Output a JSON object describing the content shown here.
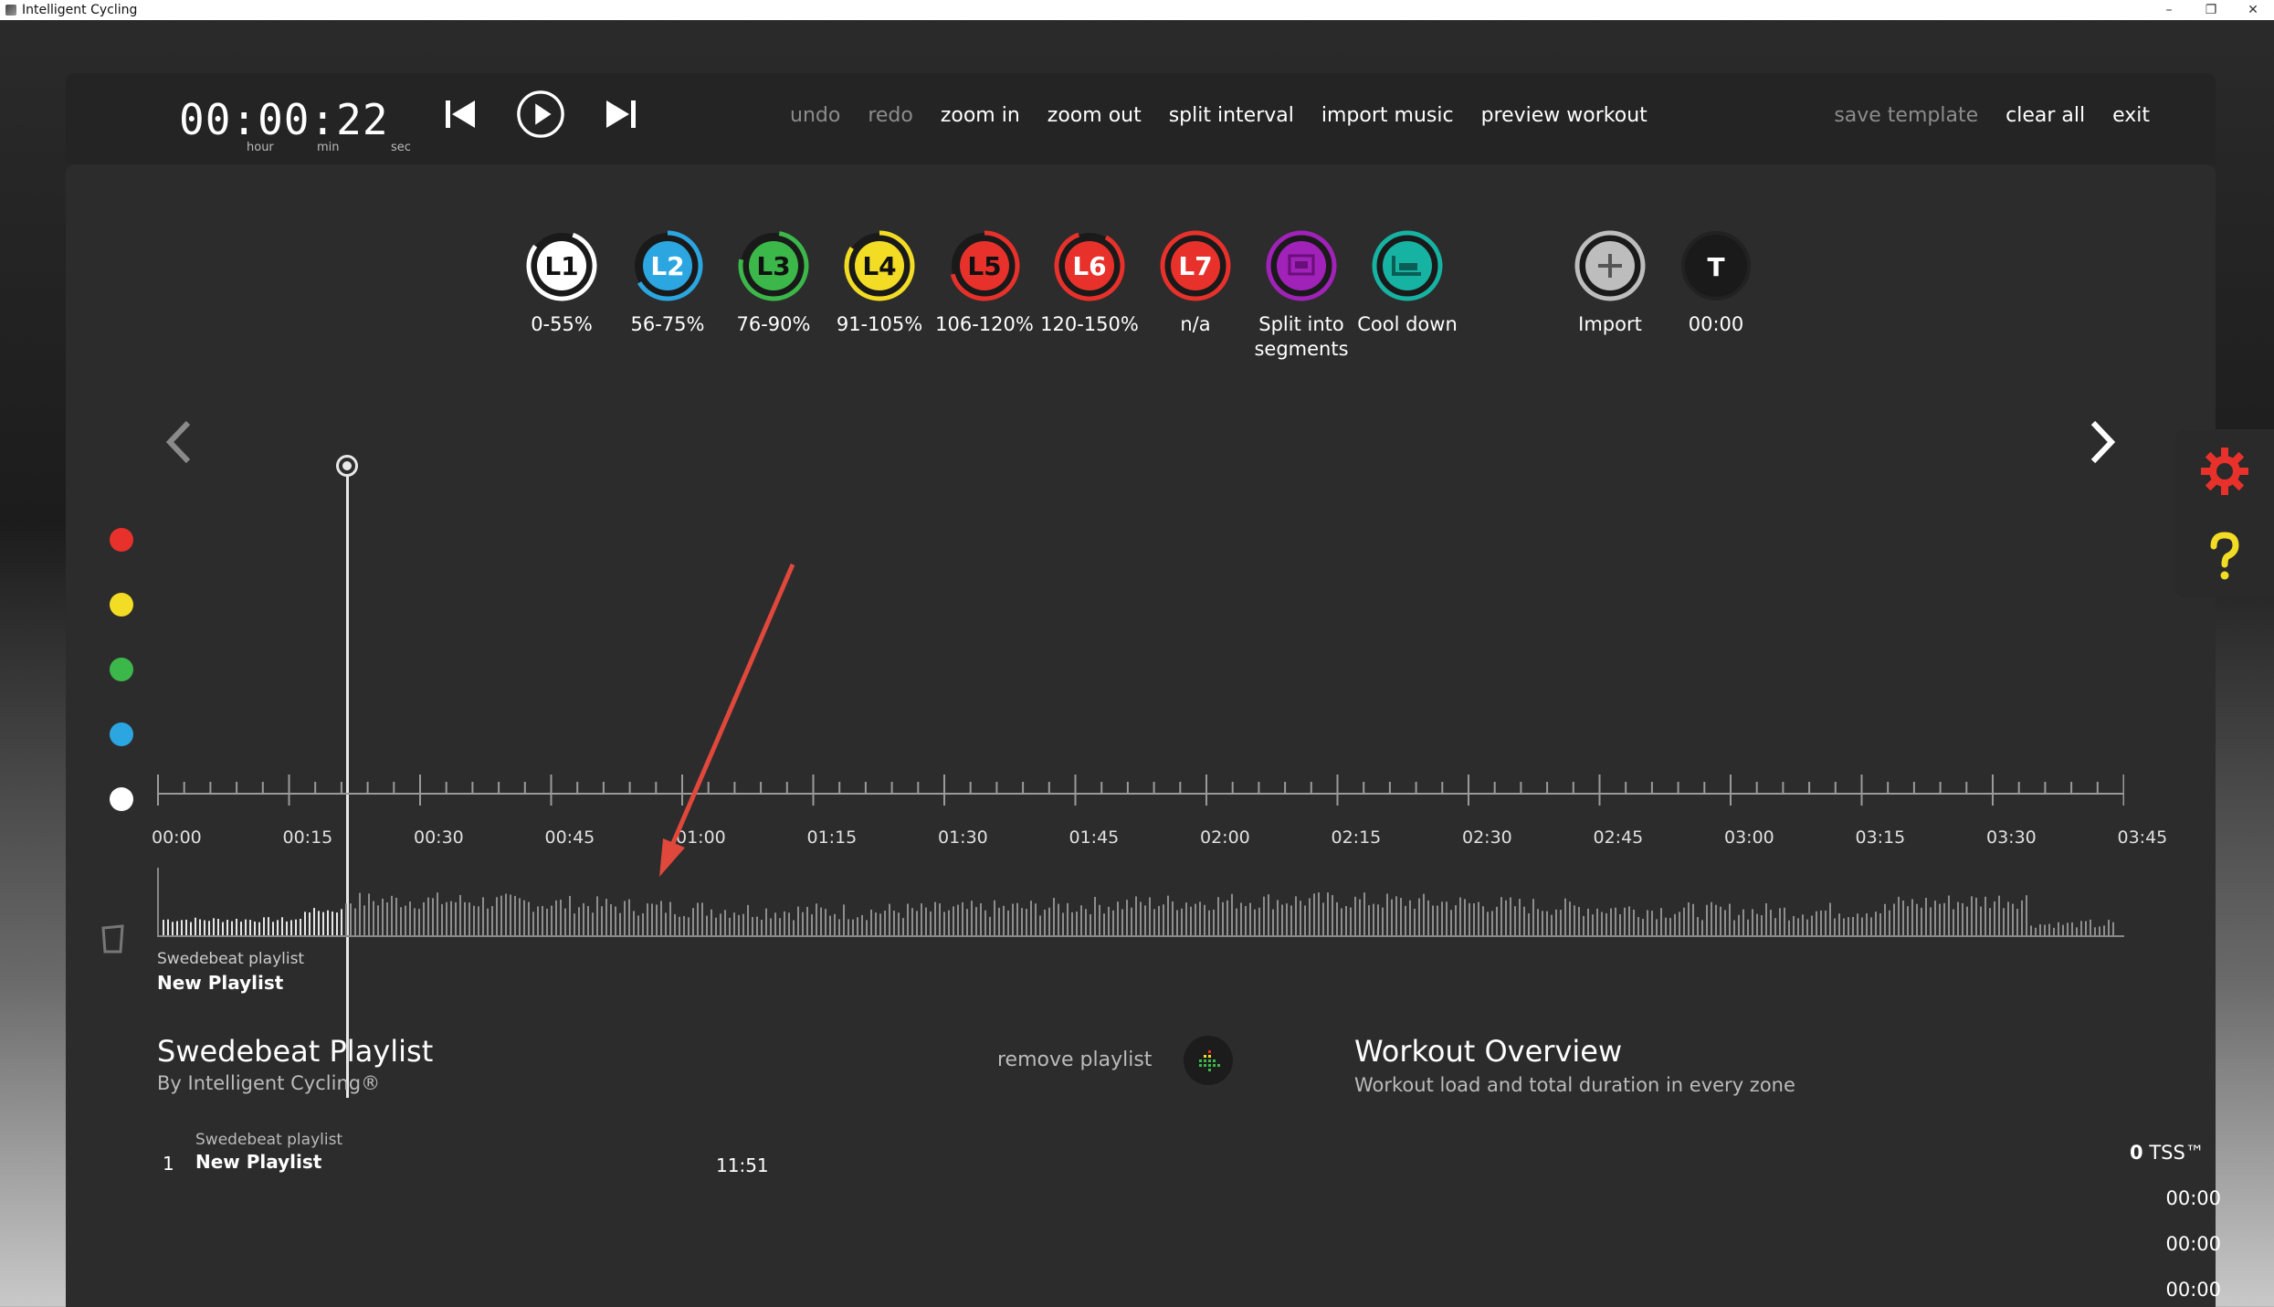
{
  "window": {
    "title": "Intelligent Cycling",
    "minimize": "–",
    "restore": "❐",
    "close": "✕"
  },
  "timer": {
    "value": "00:00:22",
    "hour_label": "hour",
    "min_label": "min",
    "sec_label": "sec"
  },
  "menu": {
    "undo": "undo",
    "redo": "redo",
    "zoom_in": "zoom in",
    "zoom_out": "zoom out",
    "split_interval": "split interval",
    "import_music": "import music",
    "preview_workout": "preview workout",
    "save_template": "save template",
    "clear_all": "clear all",
    "exit": "exit"
  },
  "zones": [
    {
      "label": "L1",
      "range": "0-55%",
      "color": "#ffffff",
      "text_color": "#111111"
    },
    {
      "label": "L2",
      "range": "56-75%",
      "color": "#2ba6e1",
      "text_color": "#ffffff"
    },
    {
      "label": "L3",
      "range": "76-90%",
      "color": "#3cb84a",
      "text_color": "#ffffff"
    },
    {
      "label": "L4",
      "range": "91-105%",
      "color": "#f3dd24",
      "text_color": "#111111"
    },
    {
      "label": "L5",
      "range": "106-120%",
      "color": "#e8312b",
      "text_color": "#ffffff"
    },
    {
      "label": "L6",
      "range": "120-150%",
      "color": "#e8312b",
      "text_color": "#ffffff"
    },
    {
      "label": "L7",
      "range": "n/a",
      "color": "#e8312b",
      "text_color": "#ffffff"
    }
  ],
  "actions": {
    "split_line1": "Split into",
    "split_line2": "segments",
    "cool_down": "Cool down",
    "import": "Import",
    "t_label": "T",
    "t_value": "00:00"
  },
  "timeline": {
    "ticks": [
      "00:00",
      "00:15",
      "00:30",
      "00:45",
      "01:00",
      "01:15",
      "01:30",
      "01:45",
      "02:00",
      "02:15",
      "02:30",
      "02:45",
      "03:00",
      "03:15",
      "03:30",
      "03:45"
    ]
  },
  "playlist_mini": {
    "sub": "Swedebeat playlist",
    "name": "New Playlist"
  },
  "playlist": {
    "title": "Swedebeat Playlist",
    "by": "By Intelligent Cycling®",
    "remove": "remove playlist",
    "tracks": [
      {
        "num": "1",
        "sub": "Swedebeat playlist",
        "name": "New Playlist",
        "duration": "11:51"
      }
    ]
  },
  "overview": {
    "title": "Workout Overview",
    "subtitle": "Workout load and total duration in every zone",
    "tss_value": "0",
    "tss_label": "TSS™",
    "durations": [
      "00:00",
      "00:00",
      "00:00"
    ]
  },
  "dot_colors": [
    "#e8312b",
    "#f3dd24",
    "#3cb84a",
    "#2ba6e1",
    "#ffffff"
  ]
}
